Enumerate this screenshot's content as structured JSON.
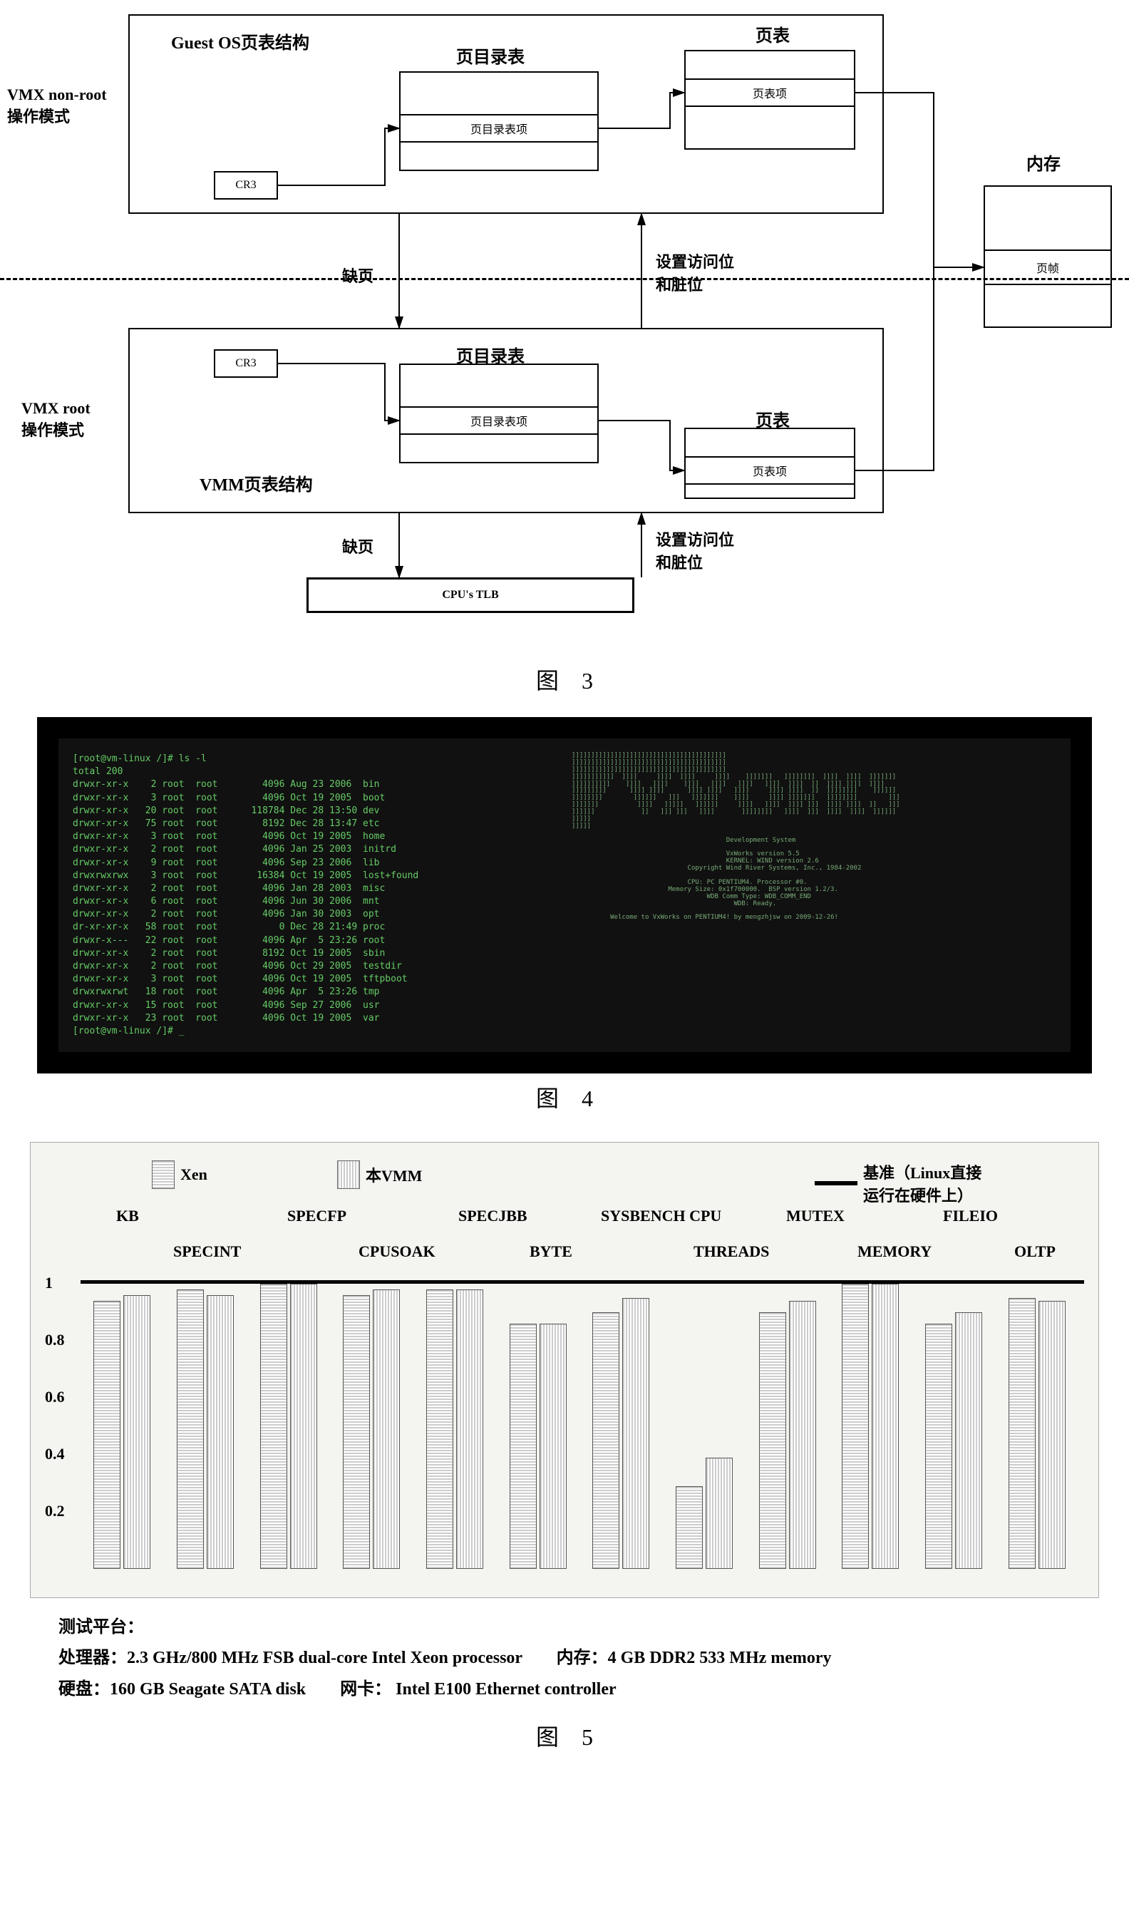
{
  "fig3": {
    "vmx_nonroot": "VMX non-root\n操作模式",
    "vmx_root": "VMX root\n操作模式",
    "guest_os_title": "Guest OS页表结构",
    "vmm_title": "VMM页表结构",
    "page_dir_table": "页目录表",
    "page_dir_entry": "页目录表项",
    "page_table": "页表",
    "page_entry": "页表项",
    "cr3": "CR3",
    "memory": "内存",
    "page_frame": "页帧",
    "page_fault": "缺页",
    "set_access": "设置访问位\n和脏位",
    "tlb": "CPU's TLB",
    "caption": "图　3"
  },
  "fig4": {
    "left_prompt": "[root@vm-linux /]# ls -l",
    "left_total": "total 200",
    "lines": [
      {
        "perm": "drwxr-xr-x",
        "n": "2",
        "u": "root",
        "g": "root",
        "size": "4096",
        "date": "Aug 23",
        "time": "2006",
        "name": "bin"
      },
      {
        "perm": "drwxr-xr-x",
        "n": "3",
        "u": "root",
        "g": "root",
        "size": "4096",
        "date": "Oct 19",
        "time": "2005",
        "name": "boot"
      },
      {
        "perm": "drwxr-xr-x",
        "n": "20",
        "u": "root",
        "g": "root",
        "size": "118784",
        "date": "Dec 28",
        "time": "13:50",
        "name": "dev"
      },
      {
        "perm": "drwxr-xr-x",
        "n": "75",
        "u": "root",
        "g": "root",
        "size": "8192",
        "date": "Dec 28",
        "time": "13:47",
        "name": "etc"
      },
      {
        "perm": "drwxr-xr-x",
        "n": "3",
        "u": "root",
        "g": "root",
        "size": "4096",
        "date": "Oct 19",
        "time": "2005",
        "name": "home"
      },
      {
        "perm": "drwxr-xr-x",
        "n": "2",
        "u": "root",
        "g": "root",
        "size": "4096",
        "date": "Jan 25",
        "time": "2003",
        "name": "initrd"
      },
      {
        "perm": "drwxr-xr-x",
        "n": "9",
        "u": "root",
        "g": "root",
        "size": "4096",
        "date": "Sep 23",
        "time": "2006",
        "name": "lib"
      },
      {
        "perm": "drwxrwxrwx",
        "n": "3",
        "u": "root",
        "g": "root",
        "size": "16384",
        "date": "Oct 19",
        "time": "2005",
        "name": "lost+found"
      },
      {
        "perm": "drwxr-xr-x",
        "n": "2",
        "u": "root",
        "g": "root",
        "size": "4096",
        "date": "Jan 28",
        "time": "2003",
        "name": "misc"
      },
      {
        "perm": "drwxr-xr-x",
        "n": "6",
        "u": "root",
        "g": "root",
        "size": "4096",
        "date": "Jun 30",
        "time": "2006",
        "name": "mnt"
      },
      {
        "perm": "drwxr-xr-x",
        "n": "2",
        "u": "root",
        "g": "root",
        "size": "4096",
        "date": "Jan 30",
        "time": "2003",
        "name": "opt"
      },
      {
        "perm": "dr-xr-xr-x",
        "n": "58",
        "u": "root",
        "g": "root",
        "size": "0",
        "date": "Dec 28",
        "time": "21:49",
        "name": "proc"
      },
      {
        "perm": "drwxr-x---",
        "n": "22",
        "u": "root",
        "g": "root",
        "size": "4096",
        "date": "Apr  5",
        "time": "23:26",
        "name": "root"
      },
      {
        "perm": "drwxr-xr-x",
        "n": "2",
        "u": "root",
        "g": "root",
        "size": "8192",
        "date": "Oct 19",
        "time": "2005",
        "name": "sbin"
      },
      {
        "perm": "drwxr-xr-x",
        "n": "2",
        "u": "root",
        "g": "root",
        "size": "4096",
        "date": "Oct 29",
        "time": "2005",
        "name": "testdir"
      },
      {
        "perm": "drwxr-xr-x",
        "n": "3",
        "u": "root",
        "g": "root",
        "size": "4096",
        "date": "Oct 19",
        "time": "2005",
        "name": "tftpboot"
      },
      {
        "perm": "drwxrwxrwt",
        "n": "18",
        "u": "root",
        "g": "root",
        "size": "4096",
        "date": "Apr  5",
        "time": "23:26",
        "name": "tmp"
      },
      {
        "perm": "drwxr-xr-x",
        "n": "15",
        "u": "root",
        "g": "root",
        "size": "4096",
        "date": "Sep 27",
        "time": "2006",
        "name": "usr"
      },
      {
        "perm": "drwxr-xr-x",
        "n": "23",
        "u": "root",
        "g": "root",
        "size": "4096",
        "date": "Oct 19",
        "time": "2005",
        "name": "var"
      }
    ],
    "left_end": "[root@vm-linux /]# _",
    "right_title": "Development System",
    "right_ver": "VxWorks version 5.5",
    "right_kernel": "KERNEL: WIND version 2.6",
    "right_copy": "Copyright Wind River Systems, Inc., 1984-2002",
    "right_cpu": "CPU: PC PENTIUM4. Processor #0.",
    "right_mem": "Memory Size: 0x1f700000.  BSP version 1.2/3.",
    "right_wdb": "WDB Comm Type: WDB_COMM_END",
    "right_ready": "WDB: Ready.",
    "right_welcome": "Welcome to VxWorks on PENTIUM4! by mengzhjsw on 2009-12-26!",
    "caption": "图　4"
  },
  "fig5": {
    "legend_xen": "Xen",
    "legend_vmm": "本VMM",
    "legend_base": "基准（Linux直接\n运行在硬件上）",
    "platform_title": "测试平台：",
    "platform_cpu": "处理器：2.3 GHz/800 MHz FSB dual-core Intel Xeon processor　　内存：4 GB  DDR2 533 MHz memory",
    "platform_disk": "硬盘：160 GB Seagate SATA disk　　网卡：  Intel E100 Ethernet controller",
    "caption": "图　5"
  },
  "chart_data": {
    "type": "bar",
    "ylim": [
      0,
      1.05
    ],
    "yticks": [
      0.2,
      0.4,
      0.6,
      0.8,
      1
    ],
    "baseline": 1.0,
    "categories": [
      "KB",
      "SPECINT",
      "SPECFP",
      "CPUSOAK",
      "SPECJBB",
      "BYTE",
      "SYSBENCH CPU",
      "THREADS",
      "MUTEX",
      "MEMORY",
      "FILEIO",
      "OLTP"
    ],
    "series": [
      {
        "name": "Xen",
        "values": [
          0.94,
          0.98,
          1.0,
          0.96,
          0.98,
          0.86,
          0.9,
          0.29,
          0.9,
          1.0,
          0.86,
          0.95
        ]
      },
      {
        "name": "本VMM",
        "values": [
          0.96,
          0.96,
          1.0,
          0.98,
          0.98,
          0.86,
          0.95,
          0.39,
          0.94,
          1.0,
          0.9,
          0.94
        ]
      }
    ],
    "label_row1": [
      "KB",
      "SPECFP",
      "SPECJBB",
      "SYSBENCH CPU",
      "MUTEX",
      "FILEIO"
    ],
    "label_row1_x": [
      120,
      360,
      600,
      800,
      1060,
      1280
    ],
    "label_row2": [
      "SPECINT",
      "CPUSOAK",
      "BYTE",
      "THREADS",
      "MEMORY",
      "OLTP"
    ],
    "label_row2_x": [
      200,
      460,
      700,
      930,
      1160,
      1380
    ]
  }
}
